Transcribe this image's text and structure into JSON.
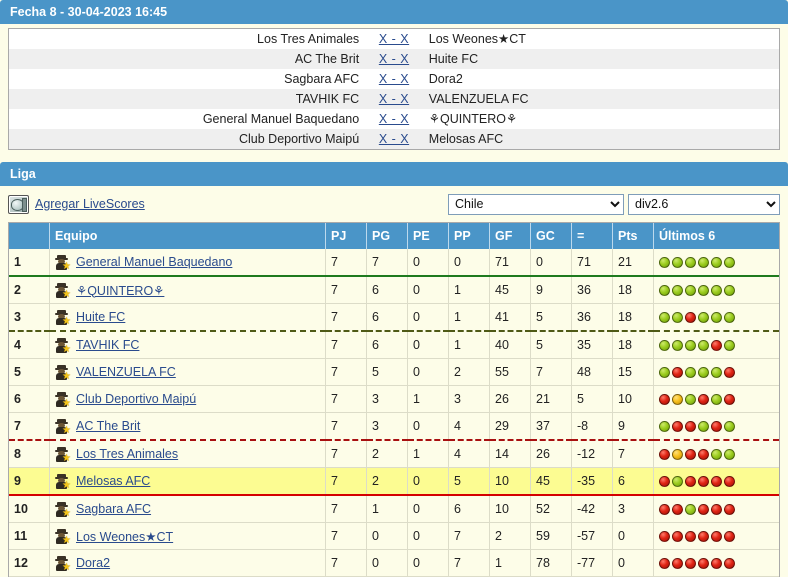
{
  "fixtures_header": {
    "title": "Fecha 8 - 30-04-2023 16:45"
  },
  "fixtures": [
    {
      "home": "Los Tres Animales",
      "score": "X - X",
      "away": "Los Weones★CT"
    },
    {
      "home": "AC The Brit",
      "score": "X - X",
      "away": "Huite FC"
    },
    {
      "home": "Sagbara AFC",
      "score": "X - X",
      "away": "Dora2"
    },
    {
      "home": "TAVHIK FC",
      "score": "X - X",
      "away": "VALENZUELA FC"
    },
    {
      "home": "General Manuel Baquedano",
      "score": "X - X",
      "away": "⚘QUINTERO⚘"
    },
    {
      "home": "Club Deportivo Maipú",
      "score": "X - X",
      "away": "Melosas AFC"
    }
  ],
  "liga": {
    "title": "Liga",
    "livescores_label": "Agregar LiveScores",
    "country_select": {
      "value": "Chile",
      "options": [
        "Chile"
      ]
    },
    "division_select": {
      "value": "div2.6",
      "options": [
        "div2.6"
      ]
    }
  },
  "standings": {
    "columns": [
      "",
      "Equipo",
      "PJ",
      "PG",
      "PE",
      "PP",
      "GF",
      "GC",
      "=",
      "Pts",
      "Últimos 6"
    ],
    "rows": [
      {
        "pos": "1",
        "team": "General Manuel Baquedano",
        "pj": "7",
        "pg": "7",
        "pe": "0",
        "pp": "0",
        "gf": "71",
        "gc": "0",
        "dif": "71",
        "pts": "21",
        "form": [
          "W",
          "W",
          "W",
          "W",
          "W",
          "W"
        ],
        "separator": "sep-green",
        "highlight": false
      },
      {
        "pos": "2",
        "team": "⚘QUINTERO⚘",
        "pj": "7",
        "pg": "6",
        "pe": "0",
        "pp": "1",
        "gf": "45",
        "gc": "9",
        "dif": "36",
        "pts": "18",
        "form": [
          "W",
          "W",
          "W",
          "W",
          "W",
          "W"
        ],
        "separator": "",
        "highlight": false
      },
      {
        "pos": "3",
        "team": "Huite FC",
        "pj": "7",
        "pg": "6",
        "pe": "0",
        "pp": "1",
        "gf": "41",
        "gc": "5",
        "dif": "36",
        "pts": "18",
        "form": [
          "W",
          "W",
          "L",
          "W",
          "W",
          "W"
        ],
        "separator": "sep-dashed-olive",
        "highlight": false
      },
      {
        "pos": "4",
        "team": "TAVHIK FC",
        "pj": "7",
        "pg": "6",
        "pe": "0",
        "pp": "1",
        "gf": "40",
        "gc": "5",
        "dif": "35",
        "pts": "18",
        "form": [
          "W",
          "W",
          "W",
          "W",
          "L",
          "W"
        ],
        "separator": "",
        "highlight": false
      },
      {
        "pos": "5",
        "team": "VALENZUELA FC",
        "pj": "7",
        "pg": "5",
        "pe": "0",
        "pp": "2",
        "gf": "55",
        "gc": "7",
        "dif": "48",
        "pts": "15",
        "form": [
          "W",
          "L",
          "W",
          "W",
          "W",
          "L"
        ],
        "separator": "",
        "highlight": false
      },
      {
        "pos": "6",
        "team": "Club Deportivo Maipú",
        "pj": "7",
        "pg": "3",
        "pe": "1",
        "pp": "3",
        "gf": "26",
        "gc": "21",
        "dif": "5",
        "pts": "10",
        "form": [
          "L",
          "D",
          "W",
          "L",
          "W",
          "L"
        ],
        "separator": "",
        "highlight": false
      },
      {
        "pos": "7",
        "team": "AC The Brit",
        "pj": "7",
        "pg": "3",
        "pe": "0",
        "pp": "4",
        "gf": "29",
        "gc": "37",
        "dif": "-8",
        "pts": "9",
        "form": [
          "W",
          "L",
          "L",
          "W",
          "L",
          "W"
        ],
        "separator": "sep-dashed-red",
        "highlight": false
      },
      {
        "pos": "8",
        "team": "Los Tres Animales",
        "pj": "7",
        "pg": "2",
        "pe": "1",
        "pp": "4",
        "gf": "14",
        "gc": "26",
        "dif": "-12",
        "pts": "7",
        "form": [
          "L",
          "D",
          "L",
          "L",
          "W",
          "W"
        ],
        "separator": "",
        "highlight": false
      },
      {
        "pos": "9",
        "team": "Melosas AFC",
        "pj": "7",
        "pg": "2",
        "pe": "0",
        "pp": "5",
        "gf": "10",
        "gc": "45",
        "dif": "-35",
        "pts": "6",
        "form": [
          "L",
          "W",
          "L",
          "L",
          "L",
          "L"
        ],
        "separator": "sep-solid-red",
        "highlight": true
      },
      {
        "pos": "10",
        "team": "Sagbara AFC",
        "pj": "7",
        "pg": "1",
        "pe": "0",
        "pp": "6",
        "gf": "10",
        "gc": "52",
        "dif": "-42",
        "pts": "3",
        "form": [
          "L",
          "L",
          "W",
          "L",
          "L",
          "L"
        ],
        "separator": "",
        "highlight": false
      },
      {
        "pos": "11",
        "team": "Los Weones★CT",
        "pj": "7",
        "pg": "0",
        "pe": "0",
        "pp": "7",
        "gf": "2",
        "gc": "59",
        "dif": "-57",
        "pts": "0",
        "form": [
          "L",
          "L",
          "L",
          "L",
          "L",
          "L"
        ],
        "separator": "",
        "highlight": false
      },
      {
        "pos": "12",
        "team": "Dora2",
        "pj": "7",
        "pg": "0",
        "pe": "0",
        "pp": "7",
        "gf": "1",
        "gc": "78",
        "dif": "-77",
        "pts": "0",
        "form": [
          "L",
          "L",
          "L",
          "L",
          "L",
          "L"
        ],
        "separator": "",
        "highlight": false
      }
    ]
  },
  "colors": {
    "header_blue": "#4a95c8",
    "page_background": "#fdfde8",
    "highlight_yellow": "#fcfc92",
    "link_blue": "#2a4b8d",
    "win_green": "#9ccd1f",
    "draw_yellow": "#f7bf1b",
    "loss_red": "#e02414"
  }
}
